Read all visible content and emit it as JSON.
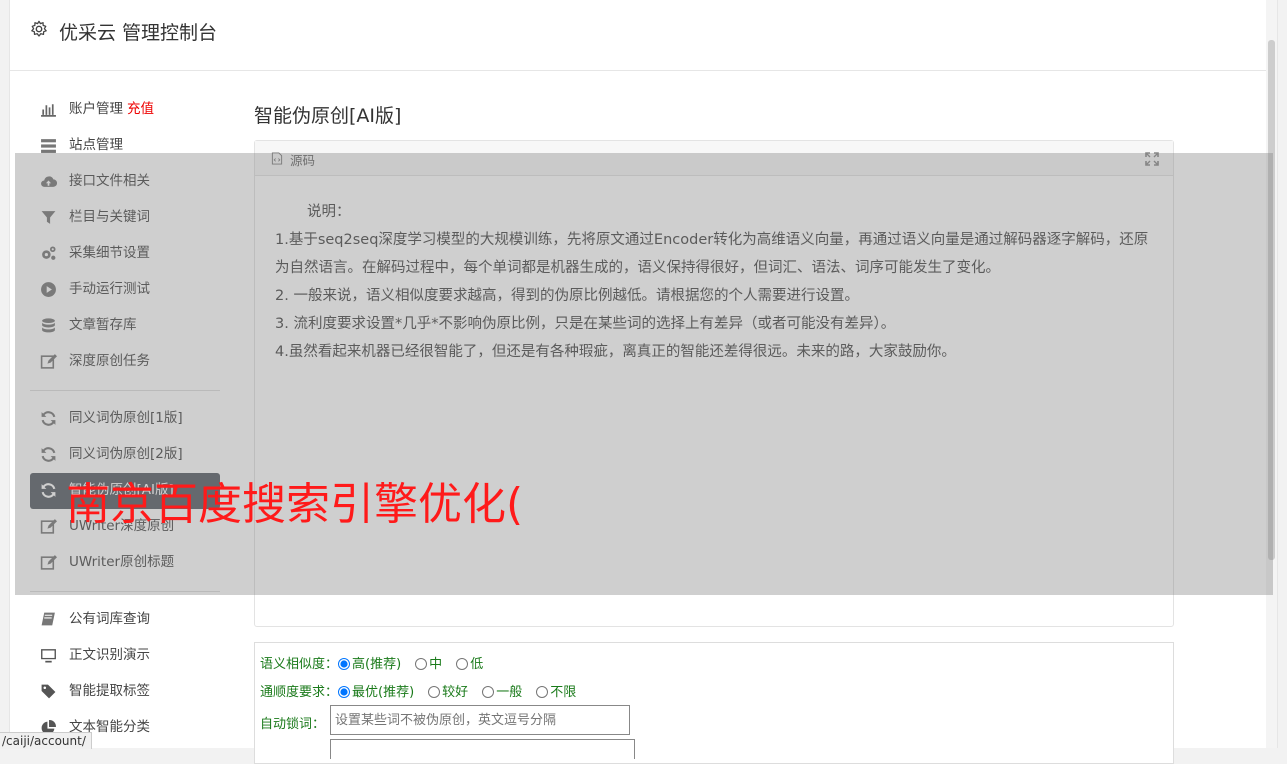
{
  "header": {
    "title": "优采云 管理控制台"
  },
  "sidebar": {
    "group1": [
      {
        "label": "账户管理",
        "badge": "充值",
        "icon": "bar-chart-icon"
      },
      {
        "label": "站点管理",
        "icon": "server-icon"
      },
      {
        "label": "接口文件相关",
        "icon": "cloud-upload-icon"
      },
      {
        "label": "栏目与关键词",
        "icon": "filter-icon"
      },
      {
        "label": "采集细节设置",
        "icon": "gears-icon"
      },
      {
        "label": "手动运行测试",
        "icon": "play-icon"
      },
      {
        "label": "文章暂存库",
        "icon": "database-icon"
      },
      {
        "label": "深度原创任务",
        "icon": "edit-icon"
      }
    ],
    "group2": [
      {
        "label": "同义词伪原创[1版]",
        "icon": "refresh-icon"
      },
      {
        "label": "同义词伪原创[2版]",
        "icon": "refresh-icon"
      },
      {
        "label": "智能伪原创[AI版]",
        "icon": "refresh-icon",
        "active": true
      },
      {
        "label": "UWriter深度原创",
        "icon": "edit-icon"
      },
      {
        "label": "UWriter原创标题",
        "icon": "edit-icon"
      }
    ],
    "group3": [
      {
        "label": "公有词库查询",
        "icon": "book-icon"
      },
      {
        "label": "正文识别演示",
        "icon": "monitor-icon"
      },
      {
        "label": "智能提取标签",
        "icon": "tag-icon"
      },
      {
        "label": "文本智能分类",
        "icon": "pie-chart-icon"
      }
    ]
  },
  "main": {
    "title": "智能伪原创[AI版]",
    "editor": {
      "source_label": "源码",
      "intro": "说明：",
      "lines": [
        "1.基于seq2seq深度学习模型的大规模训练，先将原文通过Encoder转化为高维语义向量，再通过语义向量是通过解码器逐字解码，还原为自然语言。在解码过程中，每个单词都是机器生成的，语义保持得很好，但词汇、语法、词序可能发生了变化。",
        "2. 一般来说，语义相似度要求越高，得到的伪原比例越低。请根据您的个人需要进行设置。",
        "3. 流利度要求设置*几乎*不影响伪原比例，只是在某些词的选择上有差异（或者可能没有差异）。",
        "4.虽然看起来机器已经很智能了，但还是有各种瑕疵，离真正的智能还差得很远。未来的路，大家鼓励你。"
      ]
    },
    "settings": {
      "similarity_label": "语义相似度：",
      "similarity_options": [
        "高(推荐)",
        "中",
        "低"
      ],
      "fluency_label": "通顺度要求：",
      "fluency_options": [
        "最优(推荐)",
        "较好",
        "一般",
        "不限"
      ],
      "lock_label": "自动锁词：",
      "lock_placeholder": "设置某些词不被伪原创，英文逗号分隔"
    }
  },
  "watermark": "南京百度搜索引擎优化(",
  "status_url": "/caiji/account/"
}
